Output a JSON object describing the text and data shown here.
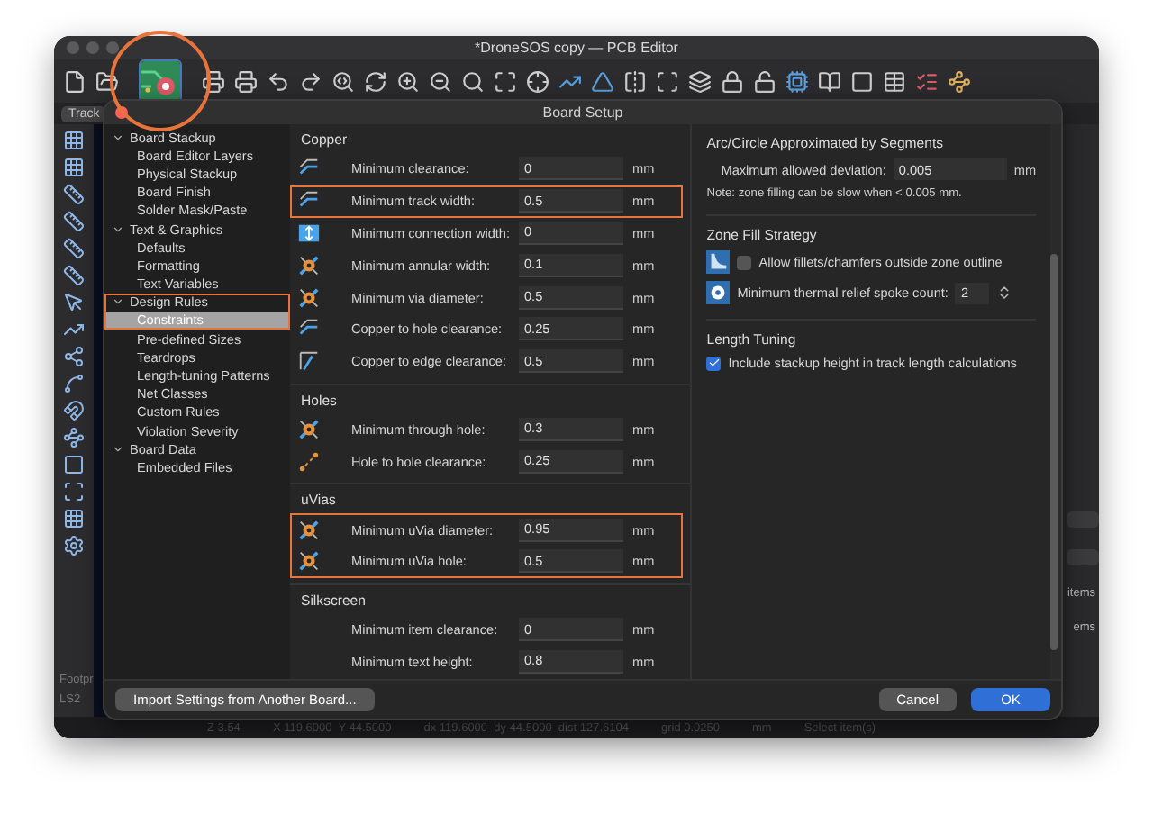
{
  "window": {
    "title": "*DroneSOS copy — PCB Editor"
  },
  "track_button": "Track",
  "left_footer": [
    "Footpr",
    "LS2"
  ],
  "right_panel_texts": [
    "items",
    "ems"
  ],
  "dialog": {
    "title": "Board Setup",
    "tree": [
      {
        "label": "Board Stackup",
        "expanded": true,
        "selected": false,
        "highlighted": false,
        "children": [
          {
            "label": "Board Editor Layers",
            "selected": false,
            "highlighted": false
          },
          {
            "label": "Physical Stackup",
            "selected": false,
            "highlighted": false
          },
          {
            "label": "Board Finish",
            "selected": false,
            "highlighted": false
          },
          {
            "label": "Solder Mask/Paste",
            "selected": false,
            "highlighted": false
          }
        ]
      },
      {
        "label": "Text & Graphics",
        "expanded": true,
        "selected": false,
        "highlighted": false,
        "children": [
          {
            "label": "Defaults",
            "selected": false,
            "highlighted": false
          },
          {
            "label": "Formatting",
            "selected": false,
            "highlighted": false
          },
          {
            "label": "Text Variables",
            "selected": false,
            "highlighted": false
          }
        ]
      },
      {
        "label": "Design Rules",
        "expanded": true,
        "selected": false,
        "highlighted": true,
        "children": [
          {
            "label": "Constraints",
            "selected": true,
            "highlighted": true
          },
          {
            "label": "Pre-defined Sizes",
            "selected": false,
            "highlighted": false
          },
          {
            "label": "Teardrops",
            "selected": false,
            "highlighted": false
          },
          {
            "label": "Length-tuning Patterns",
            "selected": false,
            "highlighted": false
          },
          {
            "label": "Net Classes",
            "selected": false,
            "highlighted": false
          },
          {
            "label": "Custom Rules",
            "selected": false,
            "highlighted": false
          },
          {
            "label": "Violation Severity",
            "selected": false,
            "highlighted": false
          }
        ]
      },
      {
        "label": "Board Data",
        "expanded": true,
        "selected": false,
        "highlighted": false,
        "children": [
          {
            "label": "Embedded Files",
            "selected": false,
            "highlighted": false
          }
        ]
      }
    ],
    "sections": [
      {
        "title": "Copper",
        "has_icons": true,
        "rows": [
          {
            "label": "Minimum clearance:",
            "value": "0",
            "unit": "mm",
            "highlighted": false
          },
          {
            "label": "Minimum track width:",
            "value": "0.5",
            "unit": "mm",
            "highlighted": true
          },
          {
            "label": "Minimum connection width:",
            "value": "0",
            "unit": "mm",
            "highlighted": false
          },
          {
            "label": "Minimum annular width:",
            "value": "0.1",
            "unit": "mm",
            "highlighted": false
          },
          {
            "label": "Minimum via diameter:",
            "value": "0.5",
            "unit": "mm",
            "highlighted": false
          },
          {
            "label": "Copper to hole clearance:",
            "value": "0.25",
            "unit": "mm",
            "highlighted": false
          },
          {
            "label": "Copper to edge clearance:",
            "value": "0.5",
            "unit": "mm",
            "highlighted": false
          }
        ]
      },
      {
        "title": "Holes",
        "has_icons": true,
        "rows": [
          {
            "label": "Minimum through hole:",
            "value": "0.3",
            "unit": "mm",
            "highlighted": false
          },
          {
            "label": "Hole to hole clearance:",
            "value": "0.25",
            "unit": "mm",
            "highlighted": false
          }
        ]
      },
      {
        "title": "uVias",
        "has_icons": true,
        "rows": [
          {
            "label": "Minimum uVia diameter:",
            "value": "0.95",
            "unit": "mm",
            "highlighted": true
          },
          {
            "label": "Minimum uVia hole:",
            "value": "0.5",
            "unit": "mm",
            "highlighted": true
          }
        ]
      },
      {
        "title": "Silkscreen",
        "has_icons": false,
        "rows": [
          {
            "label": "Minimum item clearance:",
            "value": "0",
            "unit": "mm",
            "highlighted": false
          },
          {
            "label": "Minimum text height:",
            "value": "0.8",
            "unit": "mm",
            "highlighted": false
          }
        ]
      }
    ],
    "arc": {
      "title": "Arc/Circle Approximated by Segments",
      "label": "Maximum allowed deviation:",
      "value": "0.005",
      "unit": "mm",
      "note": "Note: zone filling can be slow when < 0.005 mm."
    },
    "zone_fill": {
      "title": "Zone Fill Strategy",
      "checkbox": {
        "label": "Allow fillets/chamfers outside zone outline",
        "checked": false
      },
      "spinner": {
        "label": "Minimum thermal relief spoke count:",
        "value": "2"
      }
    },
    "length_tuning": {
      "title": "Length Tuning",
      "checkbox": {
        "label": "Include stackup height in track length calculations",
        "checked": true
      }
    },
    "import_button": "Import Settings from Another Board...",
    "buttons": [
      {
        "label": "Cancel",
        "kind": "secondary"
      },
      {
        "label": "OK",
        "kind": "primary"
      }
    ]
  },
  "status_bar": [
    "Z 3.54",
    "X 119.6000  Y 44.5000",
    "dx 119.6000  dy 44.5000  dist 127.6104",
    "grid 0.0250",
    "mm",
    "Select item(s)"
  ]
}
